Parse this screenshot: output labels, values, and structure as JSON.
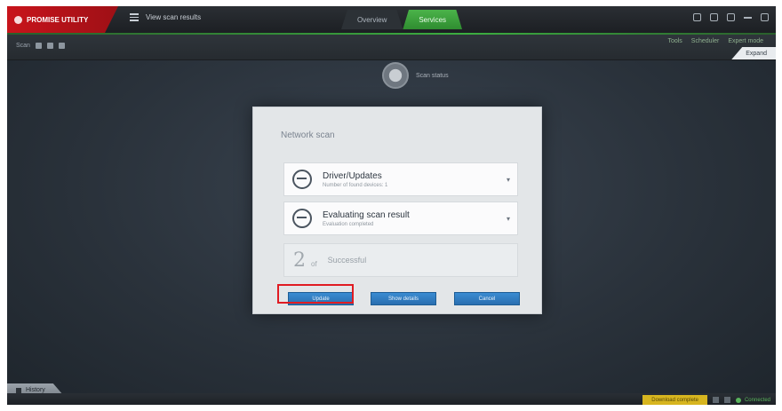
{
  "app": {
    "brand": "PROMISE UTILITY"
  },
  "titlebar": {
    "menu_label": "View scan results",
    "tabs": [
      {
        "label": "Overview",
        "active": false
      },
      {
        "label": "Services",
        "active": true
      }
    ]
  },
  "toolbar": {
    "left_label": "Scan",
    "right_items": [
      "Tools",
      "Scheduler",
      "Expert mode"
    ],
    "expand_label": "Expand"
  },
  "scan_status": {
    "label": "Scan status"
  },
  "dialog": {
    "title": "Network scan",
    "rows": [
      {
        "title": "Driver/Updates",
        "subtitle": "Number of found devices: 1"
      },
      {
        "title": "Evaluating scan result",
        "subtitle": "Evaluation completed"
      }
    ],
    "summary": {
      "count": "2",
      "unit": "of",
      "label": "Successful"
    },
    "buttons": {
      "primary": "Update",
      "secondary": "Show details",
      "tertiary": "Cancel"
    }
  },
  "bottom": {
    "history_label": "History",
    "highlight_label": "Download complete",
    "status_label": "Connected"
  },
  "colors": {
    "brand": "#c8141b",
    "accent": "#3cae40",
    "button": "#2a6fb0",
    "highlight": "#e01b22",
    "warning": "#d7b51f"
  }
}
